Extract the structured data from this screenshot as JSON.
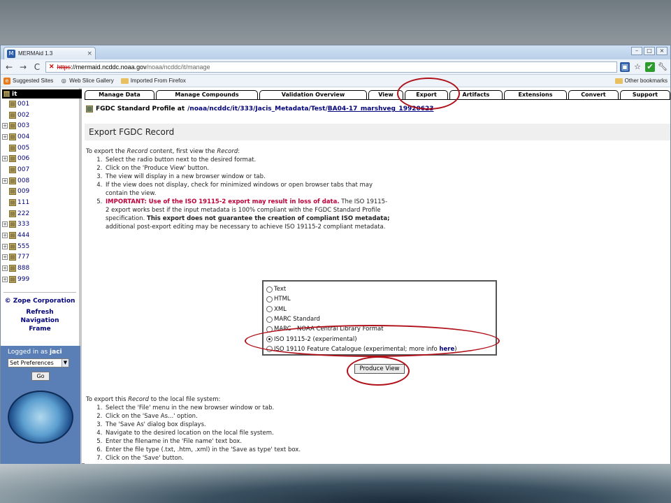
{
  "window": {
    "tab_title": "MERMAid 1.3",
    "tab_close": "×",
    "controls": [
      "–",
      "□",
      "×"
    ]
  },
  "toolbar": {
    "back": "←",
    "forward": "→",
    "reload": "C",
    "url_scheme": "https",
    "url_host": "://mermaid.ncddc.noaa.gov",
    "url_path": "/noaa/ncddc/it/manage",
    "icons": [
      "page-icon",
      "star-icon",
      "check-icon",
      "wrench-icon"
    ]
  },
  "bookmarks": {
    "items": [
      "Suggested Sites",
      "Web Slice Gallery",
      "Imported From Firefox"
    ],
    "other": "Other bookmarks"
  },
  "tree": {
    "root": "it",
    "items": [
      {
        "label": "001",
        "expandable": false
      },
      {
        "label": "002",
        "expandable": false
      },
      {
        "label": "003",
        "expandable": true
      },
      {
        "label": "004",
        "expandable": true
      },
      {
        "label": "005",
        "expandable": false
      },
      {
        "label": "006",
        "expandable": true
      },
      {
        "label": "007",
        "expandable": false
      },
      {
        "label": "008",
        "expandable": true
      },
      {
        "label": "009",
        "expandable": false
      },
      {
        "label": "111",
        "expandable": false
      },
      {
        "label": "222",
        "expandable": false
      },
      {
        "label": "333",
        "expandable": true
      },
      {
        "label": "444",
        "expandable": true
      },
      {
        "label": "555",
        "expandable": true
      },
      {
        "label": "777",
        "expandable": true
      },
      {
        "label": "888",
        "expandable": true
      },
      {
        "label": "999",
        "expandable": true
      }
    ]
  },
  "sidebar": {
    "copyright": "© Zope Corporation",
    "refresh": "Refresh Navigation Frame",
    "logged_in_label": "Logged in as",
    "user": "jaci",
    "prefs_value": "Set Preferences",
    "go_label": "Go"
  },
  "tabs": [
    {
      "label": "Manage Data",
      "width": 100
    },
    {
      "label": "Manage Compounds",
      "width": 146
    },
    {
      "label": "Validation Overview",
      "width": 154
    },
    {
      "label": "View",
      "width": 50
    },
    {
      "label": "Export",
      "width": 62,
      "active": true
    },
    {
      "label": "Artifacts",
      "width": 76
    },
    {
      "label": "Extensions",
      "width": 90
    },
    {
      "label": "Convert",
      "width": 72
    },
    {
      "label": "Support",
      "width": 72
    }
  ],
  "profile": {
    "label": "FGDC Standard Profile at",
    "path": "/noaa/ncddc/it/333/Jacis_Metadata/Test/",
    "record_link": "BA04-17_marshveg_19920623"
  },
  "heading": "Export FGDC Record",
  "instructions_view": {
    "intro_pre": "To export the ",
    "intro_em": "Record",
    "intro_mid": " content, first view the ",
    "intro_em2": "Record",
    "intro_post": ":",
    "steps": [
      "Select the radio button next to the desired format.",
      "Click on the 'Produce View' button.",
      "The view will display in a new browser window or tab.",
      "If the view does not display, check for minimized windows or open browser tabs that may contain the view."
    ],
    "step5_important": "IMPORTANT: Use of the ISO 19115-2 export may result in loss of data.",
    "step5_a": " The ISO 19115-2 export works best if the input metadata is 100% compliant with the FGDC Standard Profile specification. ",
    "step5_bold": "This export does not guarantee the creation of compliant ISO metadata;",
    "step5_b": " additional post-export editing may be necessary to achieve ISO 19115-2 compliant metadata."
  },
  "formats": {
    "options": [
      {
        "label": "Text",
        "checked": false
      },
      {
        "label": "HTML",
        "checked": false
      },
      {
        "label": "XML",
        "checked": false
      },
      {
        "label": "MARC Standard",
        "checked": false
      },
      {
        "label": "MARC - NOAA Central Library Format",
        "checked": false
      },
      {
        "label": "ISO 19115-2 (experimental)",
        "checked": true
      }
    ],
    "last_option_pre": "ISO 19110 Feature Catalogue (experimental; more info ",
    "last_option_link": "here",
    "last_option_post": ")"
  },
  "produce_view_label": "Produce View",
  "instructions_local": {
    "intro_pre": "To export this ",
    "intro_em": "Record",
    "intro_post": " to the local file system:",
    "steps": [
      "Select the 'File' menu in the new browser window or tab.",
      "Click on the 'Save As...' option.",
      "The 'Save As' dialog box displays.",
      "Navigate to the desired location on the local file system.",
      "Enter the filename in the 'File name' text box.",
      "Enter the file type (.txt, .htm, .xml) in the 'Save as type' text box.",
      "Click on the 'Save' button."
    ]
  },
  "colors": {
    "annotation": "#b0101a",
    "link": "#00007a",
    "important": "#c0003a",
    "login_panel": "#5a7fb6"
  }
}
